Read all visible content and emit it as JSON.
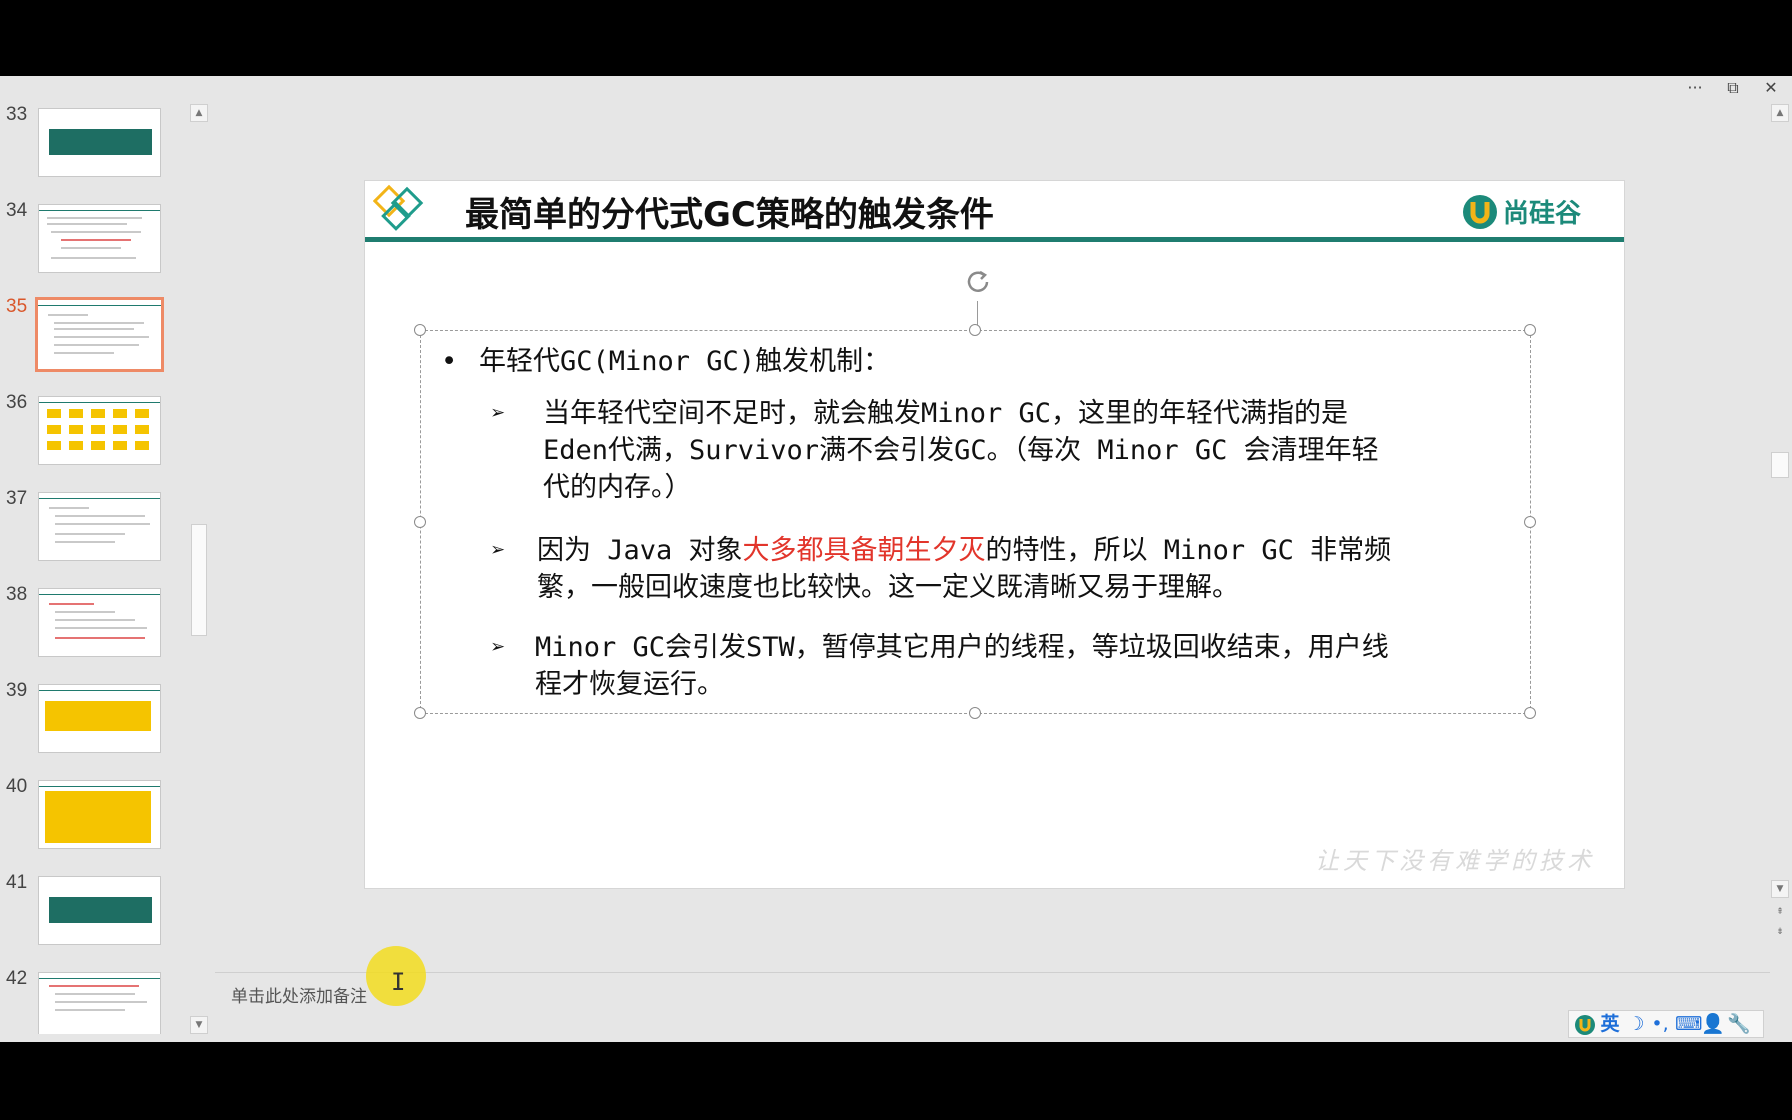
{
  "window": {
    "more_icon": "more-horizontal-icon",
    "restore_icon": "restore-window-icon",
    "close_icon": "close-icon",
    "more_glyph": "···",
    "restore_glyph": "⧉",
    "close_glyph": "✕"
  },
  "thumbnails": {
    "selected": "35",
    "items": [
      {
        "number": "33",
        "kind": "green-title"
      },
      {
        "number": "34",
        "kind": "text"
      },
      {
        "number": "35",
        "kind": "text"
      },
      {
        "number": "36",
        "kind": "yellow-grid"
      },
      {
        "number": "37",
        "kind": "text"
      },
      {
        "number": "38",
        "kind": "text"
      },
      {
        "number": "39",
        "kind": "yellow-block"
      },
      {
        "number": "40",
        "kind": "yellow-block"
      },
      {
        "number": "41",
        "kind": "green-title"
      },
      {
        "number": "42",
        "kind": "text"
      }
    ]
  },
  "slide": {
    "title": "最简单的分代式GC策略的触发条件",
    "brand": "尚硅谷",
    "bullet": "年轻代GC(Minor GC)触发机制：",
    "items": [
      {
        "line1": "当年轻代空间不足时，就会触发Minor GC，这里的年轻代满指的是",
        "line2": "Eden代满，Survivor满不会引发GC。（每次 Minor GC 会清理年轻",
        "line3": "代的内存。）"
      },
      {
        "line1_a": "因为 Java 对象",
        "line1_red": "大多都具备朝生夕灭",
        "line1_b": "的特性，所以 Minor GC 非常频",
        "line2": "繁，一般回收速度也比较快。这一定义既清晰又易于理解。"
      },
      {
        "line1": "Minor GC会引发STW，暂停其它用户的线程，等垃圾回收结束，用户线",
        "line2": "程才恢复运行。"
      }
    ],
    "watermark": "让天下没有难学的技术",
    "accent_color": "#1f7d70",
    "highlight_color": "#e2352b"
  },
  "notes": {
    "placeholder": "单击此处添加备注"
  },
  "ime": {
    "lang": "英",
    "icons": [
      "logo-icon",
      "moon-icon",
      "punctuation-icon",
      "keyboard-icon",
      "user-icon",
      "wrench-icon"
    ]
  }
}
